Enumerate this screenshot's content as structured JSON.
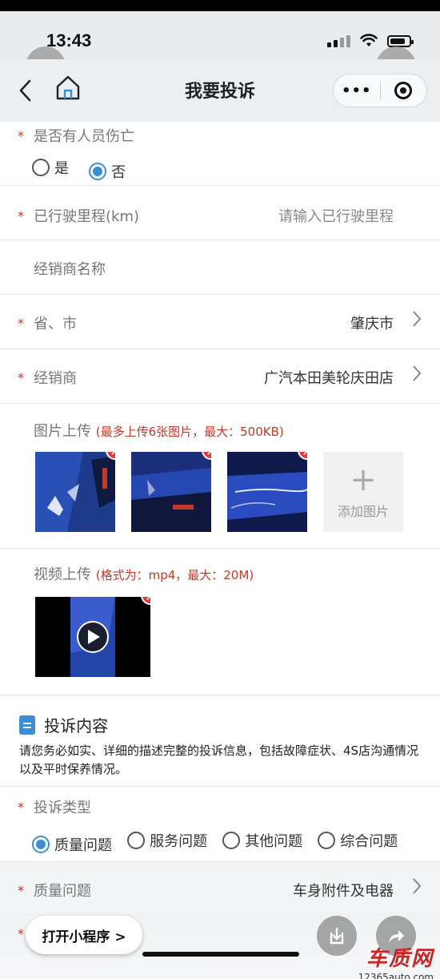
{
  "status": {
    "time": "13:43"
  },
  "nav": {
    "title": "我要投诉",
    "back_icon": "chevron-left-icon",
    "home_icon": "home-icon",
    "more_icon": "more-dots-icon",
    "close_icon": "close-icon"
  },
  "casualty": {
    "label": "是否有人员伤亡",
    "options": [
      "是",
      "否"
    ],
    "selected": "否"
  },
  "mileage": {
    "label": "已行驶里程(km)",
    "placeholder": "请输入已行驶里程"
  },
  "dealer_name": {
    "label": "经销商名称"
  },
  "province_city": {
    "label": "省、市",
    "value": "肇庆市"
  },
  "dealer": {
    "label": "经销商",
    "value": "广汽本田美轮庆田店"
  },
  "image_upload": {
    "label": "图片上传",
    "hint": "(最多上传6张图片，最大：500KB)",
    "add_label": "添加图片",
    "watermark": "12365auto.com"
  },
  "video_upload": {
    "label": "视频上传",
    "hint": "(格式为：mp4，最大：20M)"
  },
  "complaint_content": {
    "title": "投诉内容",
    "description": "请您务必如实、详细的描述完整的投诉信息，包括故障症状、4S店沟通情况以及平时保养情况。"
  },
  "complaint_type": {
    "label": "投诉类型",
    "options": [
      "质量问题",
      "服务问题",
      "其他问题",
      "综合问题"
    ],
    "selected": "质量问题"
  },
  "quality_issue": {
    "label": "质量问题",
    "value": "车身附件及电器"
  },
  "footer": {
    "open_label": "打开小程序 >"
  },
  "watermark": {
    "brand": "车质网",
    "url": "12365auto.com"
  },
  "colors": {
    "accent": "#3b8ed6",
    "required": "#c0392b",
    "delete": "#e53935"
  }
}
